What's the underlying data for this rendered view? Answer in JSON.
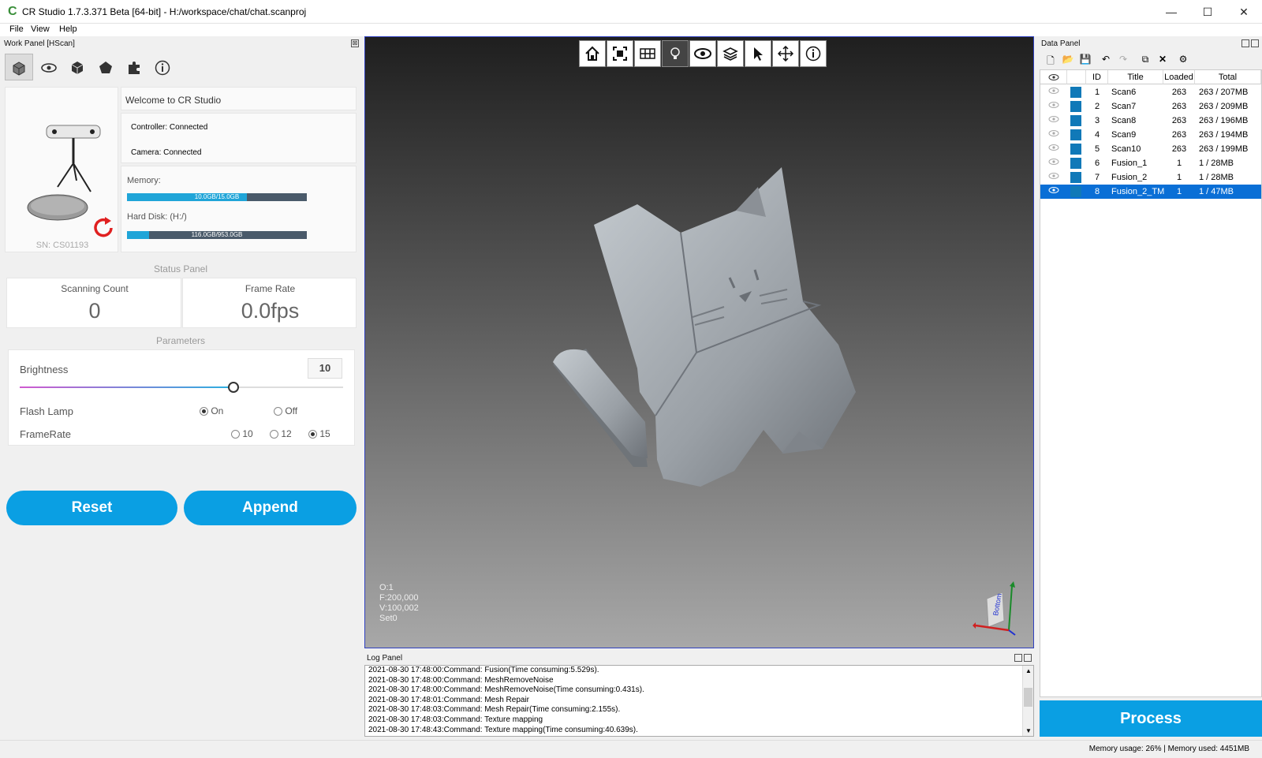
{
  "window": {
    "title": "CR Studio 1.7.3.371 Beta [64-bit] - H:/workspace/chat/chat.scanproj",
    "minimize": "—",
    "maximize": "☐",
    "close": "✕"
  },
  "menu": {
    "items": [
      "File",
      "View",
      "Help"
    ]
  },
  "work_panel": {
    "caption": "Work Panel [HScan]",
    "close": "⊠",
    "tabs": [
      "scan-cube-icon",
      "eye-icon",
      "mesh-cube-icon",
      "polygon-icon",
      "puzzle-icon",
      "info-icon"
    ],
    "device": {
      "serial": "SN: CS01193",
      "welcome": "Welcome to CR Studio",
      "controller": "Controller: Connected",
      "camera": "Camera: Connected",
      "memory_label": "Memory:",
      "memory_text": "10.0GB/15.0GB",
      "memory_fraction": 0.667,
      "disk_label": "Hard Disk: (H:/)",
      "disk_text": "116.0GB/953.0GB",
      "disk_fraction": 0.122
    },
    "status_panel": {
      "title": "Status Panel",
      "scanning_count_label": "Scanning Count",
      "scanning_count_value": "0",
      "frame_rate_label": "Frame Rate",
      "frame_rate_value": "0.0fps"
    },
    "parameters": {
      "title": "Parameters",
      "brightness_label": "Brightness",
      "brightness_value": "10",
      "brightness_fraction": 0.66,
      "flash_label": "Flash Lamp",
      "flash_on": "On",
      "flash_off": "Off",
      "framerate_label": "FrameRate",
      "fr_10": "10",
      "fr_12": "12",
      "fr_15": "15"
    },
    "reset_label": "Reset",
    "append_label": "Append"
  },
  "viewport": {
    "tools": [
      "home-icon",
      "fit-view-icon",
      "texture-icon",
      "light-icon",
      "eye-icon",
      "layers-icon",
      "select-cursor-icon",
      "move-icon",
      "info-icon"
    ],
    "stats": [
      "O:1",
      "F:200,000",
      "V:100,002",
      "Set0"
    ],
    "axis_label": "Bottom"
  },
  "log_panel": {
    "caption": "Log Panel",
    "lines": [
      "2021-08-30 17:48:00:Command: Fusion(Time consuming:5.529s).",
      "2021-08-30 17:48:00:Command: MeshRemoveNoise",
      "2021-08-30 17:48:00:Command: MeshRemoveNoise(Time consuming:0.431s).",
      "2021-08-30 17:48:01:Command: Mesh Repair",
      "2021-08-30 17:48:03:Command: Mesh Repair(Time consuming:2.155s).",
      "2021-08-30 17:48:03:Command: Texture mapping",
      "2021-08-30 17:48:43:Command: Texture mapping(Time consuming:40.639s)."
    ]
  },
  "data_panel": {
    "caption": "Data Panel",
    "headers": [
      "ID",
      "Title",
      "Loaded",
      "Total"
    ],
    "rows": [
      {
        "id": "1",
        "title": "Scan6",
        "loaded": "263",
        "total": "263 / 207MB"
      },
      {
        "id": "2",
        "title": "Scan7",
        "loaded": "263",
        "total": "263 / 209MB"
      },
      {
        "id": "3",
        "title": "Scan8",
        "loaded": "263",
        "total": "263 / 196MB"
      },
      {
        "id": "4",
        "title": "Scan9",
        "loaded": "263",
        "total": "263 / 194MB"
      },
      {
        "id": "5",
        "title": "Scan10",
        "loaded": "263",
        "total": "263 / 199MB"
      },
      {
        "id": "6",
        "title": "Fusion_1",
        "loaded": "1",
        "total": "1 / 28MB"
      },
      {
        "id": "7",
        "title": "Fusion_2",
        "loaded": "1",
        "total": "1 / 28MB"
      },
      {
        "id": "8",
        "title": "Fusion_2_TM",
        "loaded": "1",
        "total": "1 / 47MB"
      }
    ],
    "selected_row": 7,
    "process_label": "Process"
  },
  "status_bar": {
    "text": "Memory usage: 26% | Memory used: 4451MB"
  },
  "colors": {
    "accent": "#0a9fe3",
    "selection": "#0a6fd6",
    "swatch": "#1079b8"
  }
}
